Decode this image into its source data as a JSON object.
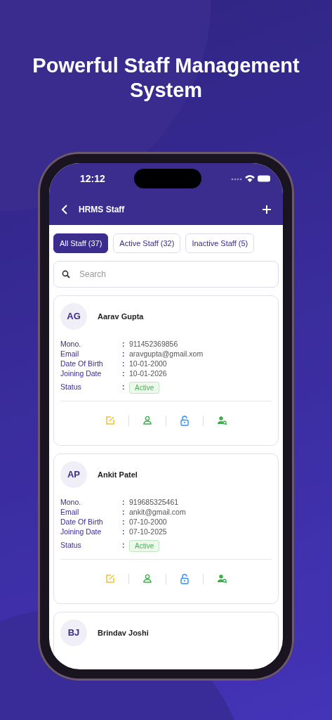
{
  "headline": "Powerful Staff Management System",
  "status_bar": {
    "time": "12:12"
  },
  "app_bar": {
    "title": "HRMS Staff"
  },
  "tabs": [
    {
      "label": "All Staff (37)",
      "selected": true
    },
    {
      "label": "Active Staff (32)",
      "selected": false
    },
    {
      "label": "Inactive Staff (5)",
      "selected": false
    }
  ],
  "search": {
    "placeholder": "Search"
  },
  "staff": [
    {
      "initials": "AG",
      "name": "Aarav Gupta",
      "fields": [
        {
          "label": "Mono.",
          "separator": ":",
          "value": "911452369856"
        },
        {
          "label": "Email",
          "separator": ":",
          "value": "aravgupta@gmail.xom"
        },
        {
          "label": "Date Of Birth",
          "separator": ":",
          "value": "10-01-2000"
        },
        {
          "label": "Joining Date",
          "separator": ":",
          "value": "10-01-2026"
        }
      ],
      "status_label": "Status",
      "status_separator": ":",
      "status": "Active"
    },
    {
      "initials": "AP",
      "name": "Ankit Patel",
      "fields": [
        {
          "label": "Mono.",
          "separator": ":",
          "value": "919685325461"
        },
        {
          "label": "Email",
          "separator": ":",
          "value": "ankit@gmail.com"
        },
        {
          "label": "Date Of Birth",
          "separator": ":",
          "value": "07-10-2000"
        },
        {
          "label": "Joining Date",
          "separator": ":",
          "value": "07-10-2025"
        }
      ],
      "status_label": "Status",
      "status_separator": ":",
      "status": "Active"
    },
    {
      "initials": "BJ",
      "name": "Brindav Joshi"
    }
  ]
}
